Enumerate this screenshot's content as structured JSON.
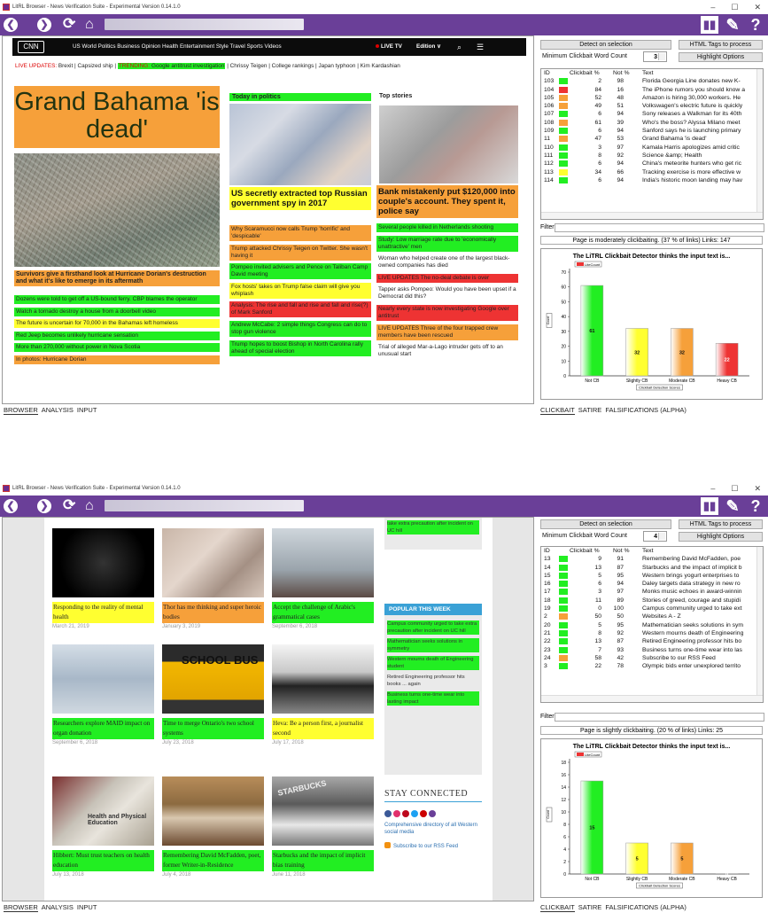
{
  "app": {
    "title": "LitRL Browser - News Verification Suite - Experimental Version 0.14.1.0",
    "min": "–",
    "max": "☐",
    "close": "✕"
  },
  "toolbar": {
    "back": "❮",
    "forward": "❯",
    "reload": "⟳",
    "home": "⌂",
    "stats": "▮▮",
    "tools": "✎",
    "help": "?"
  },
  "bottom_tabs": [
    "BROWSER",
    "ANALYSIS",
    "INPUT"
  ],
  "right_tabs": [
    "CLICKBAIT",
    "SATIRE",
    "FALSIFICATIONS (ALPHA)"
  ],
  "panel": {
    "detect_btn": "Detect on selection",
    "html_btn": "HTML Tags to process",
    "min_word_label": "Minimum Clickbait Word Count",
    "highlight_btn": "Highlight Options",
    "filter_label": "Filter",
    "col_id": "ID",
    "col_cb": "Clickbait %",
    "col_not": "Not %",
    "col_text": "Text"
  },
  "colors": {
    "green": "#22ee22",
    "orange": "#f6a03a",
    "yellow": "#ffff30",
    "red": "#ee3333",
    "purple": "#6a3f98"
  },
  "w1": {
    "min_word_count": "3",
    "rows": [
      {
        "id": "103",
        "c": "g",
        "cb": "2",
        "not": "98",
        "text": "Florida Georgia Line donates new K-"
      },
      {
        "id": "104",
        "c": "r",
        "cb": "84",
        "not": "16",
        "text": "The iPhone rumors you should know a"
      },
      {
        "id": "105",
        "c": "o",
        "cb": "52",
        "not": "48",
        "text": "Amazon is hiring 30,000 workers. He"
      },
      {
        "id": "106",
        "c": "o",
        "cb": "49",
        "not": "51",
        "text": "Volkswagen's electric future is quickly"
      },
      {
        "id": "107",
        "c": "g",
        "cb": "6",
        "not": "94",
        "text": "Sony releases a Walkman for its 40th"
      },
      {
        "id": "108",
        "c": "o",
        "cb": "61",
        "not": "39",
        "text": "Who's the boss? Alyssa Milano meet"
      },
      {
        "id": "109",
        "c": "g",
        "cb": "6",
        "not": "94",
        "text": "Sanford says he is launching primary"
      },
      {
        "id": "11",
        "c": "o",
        "cb": "47",
        "not": "53",
        "text": "Grand Bahama 'is dead'"
      },
      {
        "id": "110",
        "c": "g",
        "cb": "3",
        "not": "97",
        "text": "Kamala Harris apologizes amid critic"
      },
      {
        "id": "111",
        "c": "g",
        "cb": "8",
        "not": "92",
        "text": "Science &amp; Health"
      },
      {
        "id": "112",
        "c": "g",
        "cb": "6",
        "not": "94",
        "text": "China's meteorite hunters who get ric"
      },
      {
        "id": "113",
        "c": "y",
        "cb": "34",
        "not": "66",
        "text": "Tracking exercise is more effective w"
      },
      {
        "id": "114",
        "c": "g",
        "cb": "6",
        "not": "94",
        "text": "India's historic moon landing may hav"
      }
    ],
    "status": "Page is moderately clickbaiting. (37 % of links) Links: 147",
    "nav": {
      "logo": "CNN",
      "links": "US   World   Politics   Business   Opinion   Health   Entertainment   Style   Travel   Sports   Videos",
      "live": "LIVE TV",
      "edition": "Edition ∨",
      "search": "⌕",
      "menu": "☰"
    },
    "updates": {
      "label": "LIVE UPDATES:",
      "u1": "Brexit",
      "u2": "Capsized ship",
      "trending": "TRENDING:",
      "t1": "Google antitrust investigation",
      "t2": "Chrissy Teigen",
      "t3": "College rankings",
      "t4": "Japan typhoon",
      "t5": "Kim Kardashian"
    },
    "main_headline": "Grand Bahama 'is dead'",
    "main_caption": "Survivors give a firsthand look at Hurricane Dorian's destruction and what it's like to emerge in its aftermath",
    "main_links": [
      {
        "c": "g",
        "t": "Dozens were told to get off a US-bound ferry. CBP blames the operator"
      },
      {
        "c": "g",
        "t": "Watch a tornado destroy a house from a doorbell video"
      },
      {
        "c": "y",
        "t": "The future is uncertain for 70,000 in the Bahamas left homeless"
      },
      {
        "c": "g",
        "t": "Red Jeep becomes unlikely hurricane sensation"
      },
      {
        "c": "g",
        "t": "More than 270,000 without power in Nova Scotia"
      },
      {
        "c": "o",
        "t": "In photos: Hurricane Dorian"
      }
    ],
    "politics_title": "Today in politics",
    "politics_headline": "US secretly extracted top Russian government spy in 2017",
    "politics_links": [
      {
        "c": "o",
        "t": "Why Scaramucci now calls Trump 'horrific' and 'despicable'"
      },
      {
        "c": "o",
        "t": "Trump attacked Chrissy Teigen on Twitter. She wasn't having it"
      },
      {
        "c": "g",
        "t": "Pompeo invited advisers and Pence on Taliban Camp David meeting"
      },
      {
        "c": "y",
        "t": "Fox hosts' takes on Trump false claim will give you whiplash"
      },
      {
        "c": "r",
        "t": "Analysis: The rise and fall and rise and fall and rise(?) of Mark Sanford"
      },
      {
        "c": "g",
        "t": "Andrew McCabe: 2 simple things Congress can do to stop gun violence"
      },
      {
        "c": "g",
        "t": "Trump hopes to boost Bishop in North Carolina rally ahead of special election"
      }
    ],
    "top_title": "Top stories",
    "top_headline": "Bank mistakenly put $120,000 into couple's account. They spent it, police say",
    "top_links": [
      {
        "c": "g",
        "t": "Several people killed in Netherlands shooting"
      },
      {
        "c": "g",
        "t": "Study: Low marriage rate due to 'economically unattractive' men"
      },
      {
        "c": "",
        "t": "Woman who helped create one of the largest black-owned companies has died"
      },
      {
        "c": "r",
        "t": "LIVE UPDATES The no-deal debate is over"
      },
      {
        "c": "",
        "t": "Tapper asks Pompeo: Would you have been upset if a Democrat did this?"
      },
      {
        "c": "r",
        "t": "Nearly every state is now investigating Google over antitrust"
      },
      {
        "c": "o",
        "t": "LIVE UPDATES Three of the four trapped crew members have been rescued"
      },
      {
        "c": "",
        "t": "Trial of alleged Mar-a-Lago intruder gets off to an unusual start"
      }
    ]
  },
  "w2": {
    "min_word_count": "4",
    "rows": [
      {
        "id": "13",
        "c": "g",
        "cb": "9",
        "not": "91",
        "text": "Remembering David McFadden, poe"
      },
      {
        "id": "14",
        "c": "g",
        "cb": "13",
        "not": "87",
        "text": "Starbucks and the impact of implicit b"
      },
      {
        "id": "15",
        "c": "g",
        "cb": "5",
        "not": "95",
        "text": "Western brings yogurt enterprises to"
      },
      {
        "id": "16",
        "c": "g",
        "cb": "6",
        "not": "94",
        "text": "Daley targets data strategy in new ro"
      },
      {
        "id": "17",
        "c": "g",
        "cb": "3",
        "not": "97",
        "text": "Monks music echoes in award-winnin"
      },
      {
        "id": "18",
        "c": "g",
        "cb": "11",
        "not": "89",
        "text": "Stories of greed, courage and stupidi"
      },
      {
        "id": "19",
        "c": "g",
        "cb": "0",
        "not": "100",
        "text": "Campus community urged to take ext"
      },
      {
        "id": "2",
        "c": "o",
        "cb": "50",
        "not": "50",
        "text": "Websites A - Z"
      },
      {
        "id": "20",
        "c": "g",
        "cb": "5",
        "not": "95",
        "text": "Mathematician seeks solutions in sym"
      },
      {
        "id": "21",
        "c": "g",
        "cb": "8",
        "not": "92",
        "text": "Western mourns death of Engineering"
      },
      {
        "id": "22",
        "c": "g",
        "cb": "13",
        "not": "87",
        "text": "Retired Engineering professor hits bo"
      },
      {
        "id": "23",
        "c": "g",
        "cb": "7",
        "not": "93",
        "text": "Business turns one-time wear into las"
      },
      {
        "id": "24",
        "c": "o",
        "cb": "58",
        "not": "42",
        "text": "Subscribe to our RSS Feed"
      },
      {
        "id": "3",
        "c": "g",
        "cb": "22",
        "not": "78",
        "text": "Olympic bids enter unexplored territo"
      }
    ],
    "status": "Page is slightly clickbaiting. (20 % of links) Links: 25",
    "tiles": [
      {
        "c": "y",
        "cap": "Responding to the reality of mental health",
        "date": "March 21, 2019"
      },
      {
        "c": "o",
        "cap": "Thor has me thinking and super heroic bodies",
        "date": "January 3, 2019"
      },
      {
        "c": "g",
        "cap": "Accept the challenge of Arabic's grammatical cases",
        "date": "September 6, 2018"
      },
      {
        "c": "g",
        "cap": "Researchers explore MAID impact on organ donation",
        "date": "September 6, 2018"
      },
      {
        "c": "g",
        "cap": "Time to merge Ontario's two school systems",
        "date": "July 23, 2018"
      },
      {
        "c": "y",
        "cap": "Heva: Be a person first, a journalist second",
        "date": "July 17, 2018"
      },
      {
        "c": "g",
        "cap": "Hibbert: Must trust teachers on health education",
        "date": "July 13, 2018"
      },
      {
        "c": "g",
        "cap": "Remembering David McFadden, poet, former Writer-in-Residence",
        "date": "July 4, 2018"
      },
      {
        "c": "g",
        "cap": "Starbucks and the impact of implicit bias training",
        "date": "June 11, 2018"
      }
    ],
    "bus_sign": "SCHOOL BUS",
    "book_title": "Health and Physical Education",
    "store_sign": "STARBUCKS",
    "side_top": "take extra precaution after incident on UC hill",
    "popular_title": "POPULAR THIS WEEK",
    "popular_links": [
      {
        "c": "g",
        "t": "Campus community urged to take extra precaution after incident on UC hill"
      },
      {
        "c": "g",
        "t": "Mathematician seeks solutions in symmetry"
      },
      {
        "c": "g",
        "t": "Western mourns death of Engineering student"
      },
      {
        "c": "",
        "t": "Retired Engineering professor hits books ... again"
      },
      {
        "c": "g",
        "t": "Business turns one-time wear into lasting impact"
      }
    ],
    "stay_title": "STAY CONNECTED",
    "dir_link": "Comprehensive directory of all Western social media",
    "rss_link": "Subscribe to our RSS Feed"
  },
  "chart_data": [
    {
      "type": "bar",
      "title": "The LiTRL Clickbait Detector thinks the input text is...",
      "legend": "LiteCount",
      "ylabel": "Count",
      "xlabel": "Clickbait Detection Scores",
      "categories": [
        "Not CB",
        "Slightly CB",
        "Moderate CB",
        "Heavy CB"
      ],
      "values": [
        61,
        32,
        32,
        22
      ],
      "ylim": [
        0,
        70
      ],
      "yticks": [
        0,
        10,
        20,
        30,
        40,
        50,
        60,
        70
      ],
      "colors": [
        "#22ee22",
        "#ffff30",
        "#f6a03a",
        "#ee3333"
      ]
    },
    {
      "type": "bar",
      "title": "The LiTRL Clickbait Detector thinks the input text is...",
      "legend": "LiteCount",
      "ylabel": "Count",
      "xlabel": "Clickbait Detection Scores",
      "categories": [
        "Not CB",
        "Slightly CB",
        "Moderate CB",
        "Heavy CB"
      ],
      "values": [
        15,
        5,
        5,
        0
      ],
      "ylim": [
        0,
        18
      ],
      "yticks": [
        0,
        2,
        4,
        6,
        8,
        10,
        12,
        14,
        16,
        18
      ],
      "colors": [
        "#22ee22",
        "#ffff30",
        "#f6a03a",
        "#ee3333"
      ]
    }
  ]
}
